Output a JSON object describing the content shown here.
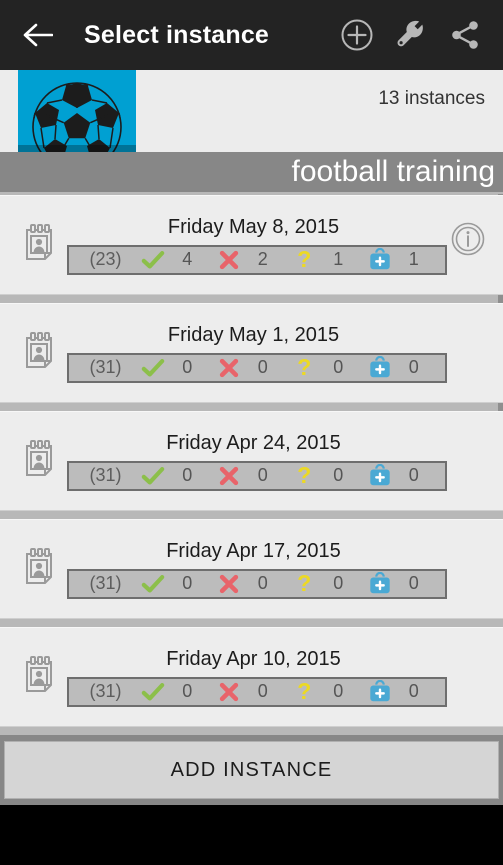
{
  "toolbar": {
    "back_icon": "arrow-left-icon",
    "title": "Select instance",
    "actions": [
      {
        "icon": "plus-circle-icon",
        "label": "Add"
      },
      {
        "icon": "wrench-icon",
        "label": "Tools"
      },
      {
        "icon": "share-icon",
        "label": "Share"
      }
    ]
  },
  "header": {
    "thumbnail_icon": "soccer-ball-icon",
    "thumbnail_bg": "#00a0d2",
    "instance_count": "13 instances",
    "activity_title": "football training"
  },
  "stat_legend": {
    "total_icon": "parentheses-total",
    "present_icon": "green-check-icon",
    "absent_icon": "red-cross-icon",
    "unknown_icon": "yellow-question-icon",
    "excused_icon": "blue-medical-bag-icon",
    "colors": {
      "check": "#8cbf4a",
      "cross": "#e8646a",
      "question": "#ecd924",
      "medical": "#4aa9d4"
    }
  },
  "instances": [
    {
      "calendar_icon": "calendar-person-icon",
      "date": "Friday May 8, 2015",
      "total": "(23)",
      "present": "4",
      "absent": "2",
      "unknown": "1",
      "excused": "1",
      "has_info": true,
      "info_icon": "info-circle-icon"
    },
    {
      "calendar_icon": "calendar-person-icon",
      "date": "Friday May 1, 2015",
      "total": "(31)",
      "present": "0",
      "absent": "0",
      "unknown": "0",
      "excused": "0",
      "has_info": false,
      "info_icon": ""
    },
    {
      "calendar_icon": "calendar-person-icon",
      "date": "Friday Apr 24, 2015",
      "total": "(31)",
      "present": "0",
      "absent": "0",
      "unknown": "0",
      "excused": "0",
      "has_info": false,
      "info_icon": ""
    },
    {
      "calendar_icon": "calendar-person-icon",
      "date": "Friday Apr 17, 2015",
      "total": "(31)",
      "present": "0",
      "absent": "0",
      "unknown": "0",
      "excused": "0",
      "has_info": false,
      "info_icon": ""
    },
    {
      "calendar_icon": "calendar-person-icon",
      "date": "Friday Apr 10, 2015",
      "total": "(31)",
      "present": "0",
      "absent": "0",
      "unknown": "0",
      "excused": "0",
      "has_info": false,
      "info_icon": ""
    }
  ],
  "footer": {
    "add_instance_label": "ADD INSTANCE"
  }
}
